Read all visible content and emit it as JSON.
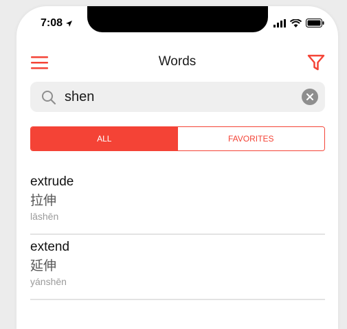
{
  "status": {
    "time": "7:08"
  },
  "navbar": {
    "title": "Words"
  },
  "search": {
    "value": "shen",
    "placeholder": ""
  },
  "tabs": [
    {
      "label": "ALL",
      "active": true
    },
    {
      "label": "FAVORITES",
      "active": false
    }
  ],
  "words": [
    {
      "english": "extrude",
      "hanzi": "拉伸",
      "pinyin": "lāshēn"
    },
    {
      "english": "extend",
      "hanzi": "延伸",
      "pinyin": "yánshēn"
    }
  ],
  "colors": {
    "accent": "#f44336",
    "search_bg": "#efefef"
  },
  "icons": [
    "location-arrow-icon",
    "signal-icon",
    "wifi-icon",
    "battery-icon",
    "menu-icon",
    "filter-icon",
    "search-icon",
    "clear-icon"
  ]
}
